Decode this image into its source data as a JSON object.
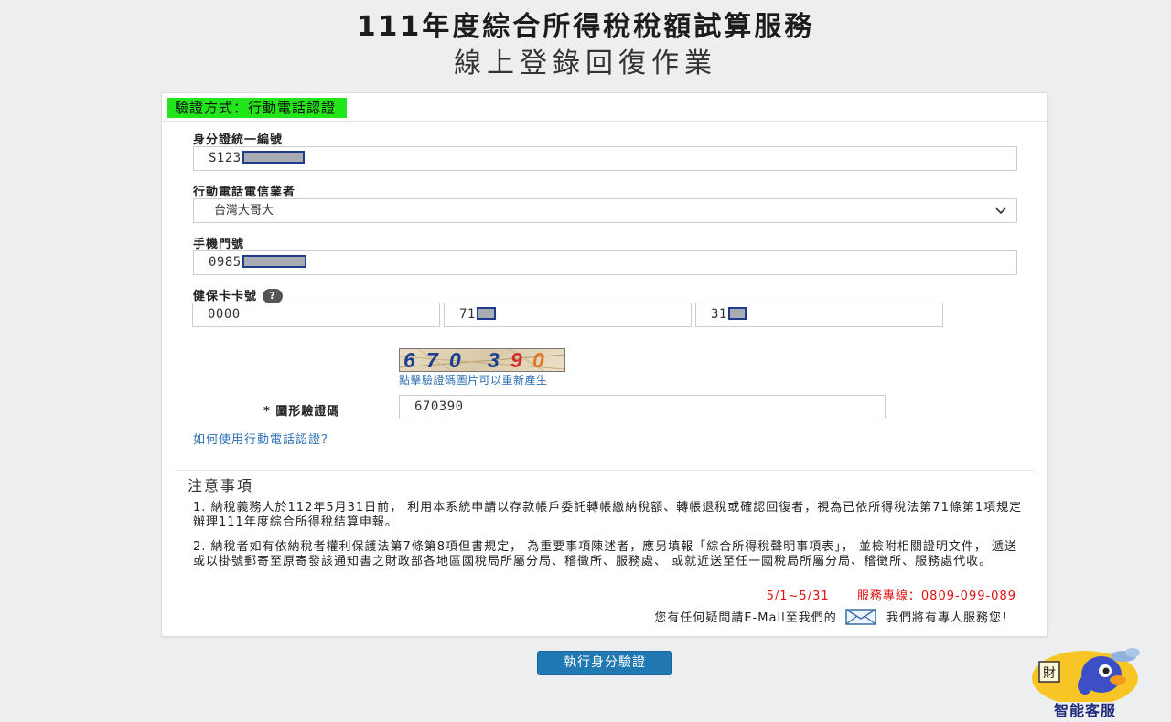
{
  "header": {
    "title": "111年度綜合所得稅稅額試算服務",
    "subtitle": "線上登錄回復作業"
  },
  "form": {
    "method_badge": "驗證方式：行動電話認證",
    "id_label": "身分證統一編號",
    "id_value": "S123",
    "carrier_label": "行動電話電信業者",
    "carrier_value": "台灣大哥大",
    "phone_label": "手機門號",
    "phone_value": "0985",
    "card_label": "健保卡卡號",
    "card_help": "?",
    "card_part1": "0000",
    "card_part2": "71",
    "card_part3": "31",
    "captcha_digits": [
      "6",
      "7",
      "0",
      "3",
      "9",
      "0"
    ],
    "captcha_refresh": "點擊驗證碼圖片可以重新產生",
    "captcha_label": "* 圖形驗證碼",
    "captcha_value": "670390",
    "howto_link": "如何使用行動電話認證？"
  },
  "notice": {
    "title": "注意事項",
    "item1": "1. 納稅義務人於112年5月31日前， 利用本系統申請以存款帳戶委託轉帳繳納稅額、轉帳退稅或確認回復者，視為已依所得稅法第71條第1項規定辦理111年度綜合所得稅結算申報。",
    "item2": "2. 納稅者如有依納稅者權利保護法第7條第8項但書規定， 為重要事項陳述者，應另填報「綜合所得稅聲明事項表」， 並檢附相關證明文件， 遞送或以掛號郵寄至原寄發該通知書之財政部各地區國稅局所屬分局、稽徵所、服務處、 或就近送至任一國稅局所屬分局、稽徵所、服務處代收。",
    "service_period": "5/1~5/31",
    "service_hotline": "服務專線：0809-099-089",
    "contact_prefix": "您有任何疑問請E-Mail至我們的",
    "contact_suffix": "我們將有專人服務您！"
  },
  "actions": {
    "submit_label": "執行身分驗證"
  },
  "bot": {
    "label": "智能客服"
  },
  "colors": {
    "badge_green": "#22e51a",
    "link_blue": "#2a6fb5",
    "button_blue": "#2179b4",
    "alert_red": "#e01010"
  }
}
